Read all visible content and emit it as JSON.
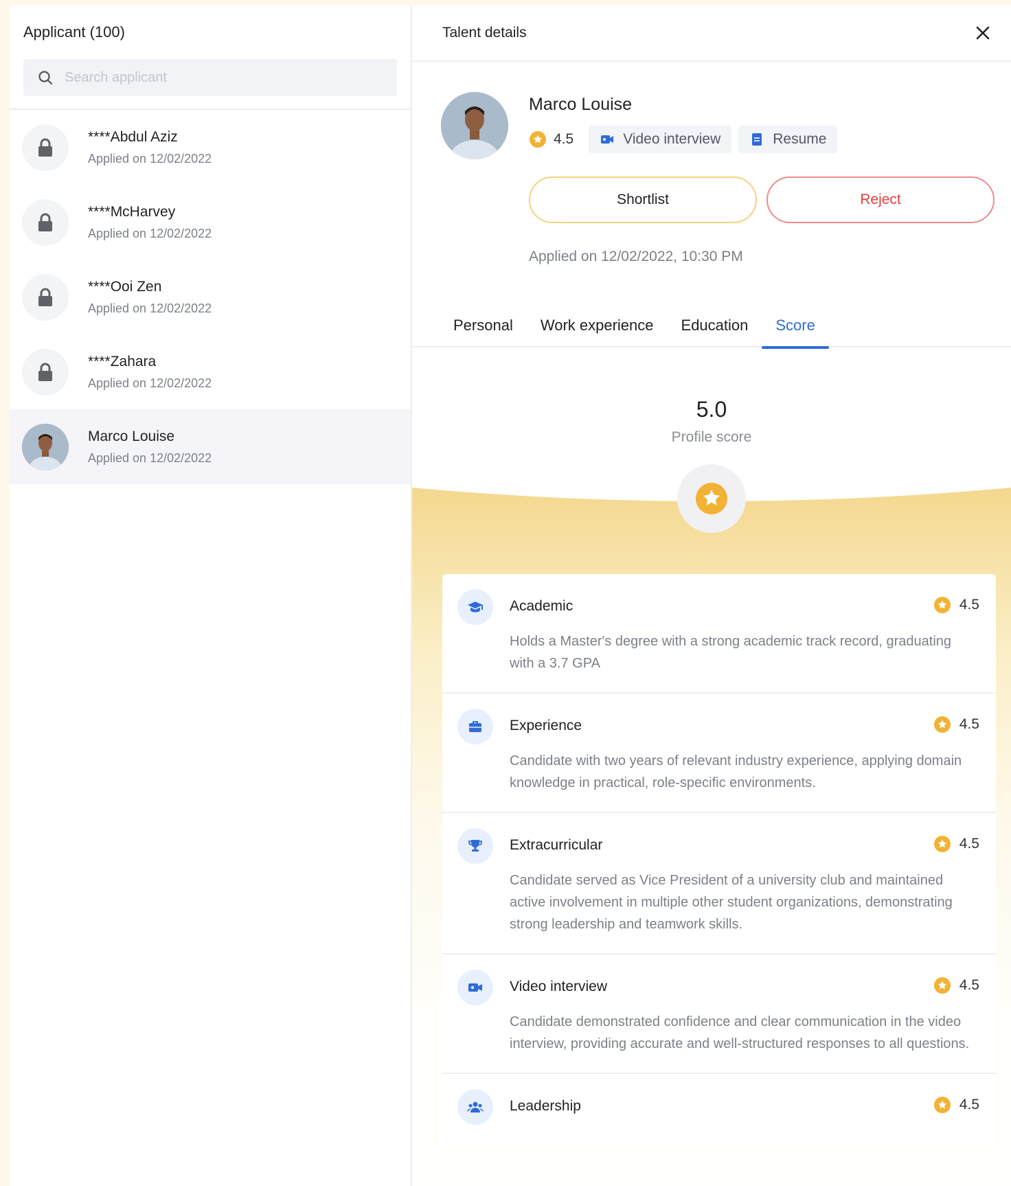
{
  "applicants_panel": {
    "title": "Applicant (100)",
    "search_placeholder": "Search applicant",
    "items": [
      {
        "name": "****Abdul Aziz",
        "applied": "Applied on 12/02/2022"
      },
      {
        "name": "****McHarvey",
        "applied": "Applied on 12/02/2022"
      },
      {
        "name": "****Ooi Zen",
        "applied": "Applied on 12/02/2022"
      },
      {
        "name": "****Zahara",
        "applied": "Applied on 12/02/2022"
      },
      {
        "name": "Marco Louise",
        "applied": "Applied on 12/02/2022"
      }
    ]
  },
  "details": {
    "title": "Talent details",
    "name": "Marco Louise",
    "rating": "4.5",
    "video_chip": "Video interview",
    "resume_chip": "Resume",
    "shortlist_label": "Shortlist",
    "reject_label": "Reject",
    "applied_full": "Applied on 12/02/2022, 10:30 PM",
    "tabs": [
      "Personal",
      "Work experience",
      "Education",
      "Score"
    ],
    "active_tab": "Score"
  },
  "score": {
    "value": "5.0",
    "label": "Profile score",
    "cards": [
      {
        "title": "Academic",
        "score": "4.5",
        "icon": "graduation-cap-icon",
        "desc": "Holds a Master's degree with a strong academic track record, graduating with a 3.7 GPA"
      },
      {
        "title": "Experience",
        "score": "4.5",
        "icon": "briefcase-icon",
        "desc": "Candidate with two years of relevant industry experience, applying domain knowledge in practical, role-specific environments."
      },
      {
        "title": "Extracurricular",
        "score": "4.5",
        "icon": "trophy-icon",
        "desc": "Candidate served as Vice President of a university club and maintained active involvement in multiple other student organizations, demonstrating strong leadership and teamwork skills."
      },
      {
        "title": "Video interview",
        "score": "4.5",
        "icon": "video-icon",
        "desc": "Candidate demonstrated confidence and clear communication in the video interview, providing accurate and well-structured responses to all questions."
      },
      {
        "title": "Leadership",
        "score": "4.5",
        "icon": "people-icon",
        "desc": ""
      }
    ]
  },
  "colors": {
    "accent_blue": "#2F6BD8",
    "star_gold": "#F2B233",
    "reject_red": "#E53E3E",
    "page_bg": "#FEF8EA"
  }
}
